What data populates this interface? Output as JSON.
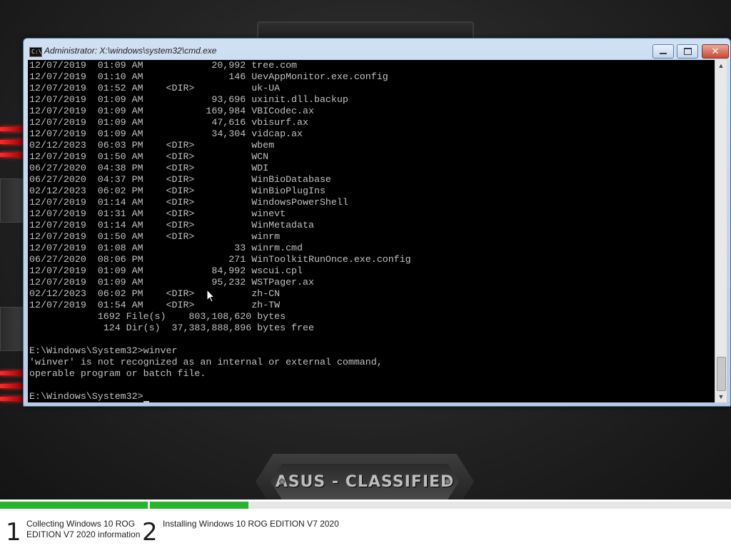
{
  "window": {
    "title": "Administrator: X:\\windows\\system32\\cmd.exe",
    "icon": "cmd-icon",
    "minimize_icon": "minimize-icon",
    "maximize_icon": "maximize-icon",
    "close_icon": "close-icon"
  },
  "console": {
    "lines": [
      "12/07/2019  01:09 AM            20,992 tree.com",
      "12/07/2019  01:10 AM               146 UevAppMonitor.exe.config",
      "12/07/2019  01:52 AM    <DIR>          uk-UA",
      "12/07/2019  01:09 AM            93,696 uxinit.dll.backup",
      "12/07/2019  01:09 AM           169,984 VBICodec.ax",
      "12/07/2019  01:09 AM            47,616 vbisurf.ax",
      "12/07/2019  01:09 AM            34,304 vidcap.ax",
      "02/12/2023  06:03 PM    <DIR>          wbem",
      "12/07/2019  01:50 AM    <DIR>          WCN",
      "06/27/2020  04:38 PM    <DIR>          WDI",
      "06/27/2020  04:37 PM    <DIR>          WinBioDatabase",
      "02/12/2023  06:02 PM    <DIR>          WinBioPlugIns",
      "12/07/2019  01:14 AM    <DIR>          WindowsPowerShell",
      "12/07/2019  01:31 AM    <DIR>          winevt",
      "12/07/2019  01:14 AM    <DIR>          WinMetadata",
      "12/07/2019  01:50 AM    <DIR>          winrm",
      "12/07/2019  01:08 AM                33 winrm.cmd",
      "06/27/2020  08:06 PM               271 WinToolkitRunOnce.exe.config",
      "12/07/2019  01:09 AM            84,992 wscui.cpl",
      "12/07/2019  01:09 AM            95,232 WSTPager.ax",
      "02/12/2023  06:02 PM    <DIR>          zh-CN",
      "12/07/2019  01:54 AM    <DIR>          zh-TW",
      "            1692 File(s)    803,108,620 bytes",
      "             124 Dir(s)  37,383,888,896 bytes free",
      "",
      "E:\\Windows\\System32>winver",
      "'winver' is not recognized as an internal or external command,",
      "operable program or batch file.",
      "",
      "E:\\Windows\\System32>"
    ],
    "text_color": "#c0c0c0",
    "background": "#000000"
  },
  "wallpaper": {
    "badge_text": "ASUS - CLASSIFIED",
    "accent_color": "#ff2a2a"
  },
  "setup": {
    "progress_color": "#26b52b",
    "steps": [
      {
        "number": "1",
        "label": "Collecting Windows 10 ROG\nEDITION V7 2020 information"
      },
      {
        "number": "2",
        "label": "Installing Windows 10 ROG EDITION V7 2020"
      }
    ]
  }
}
